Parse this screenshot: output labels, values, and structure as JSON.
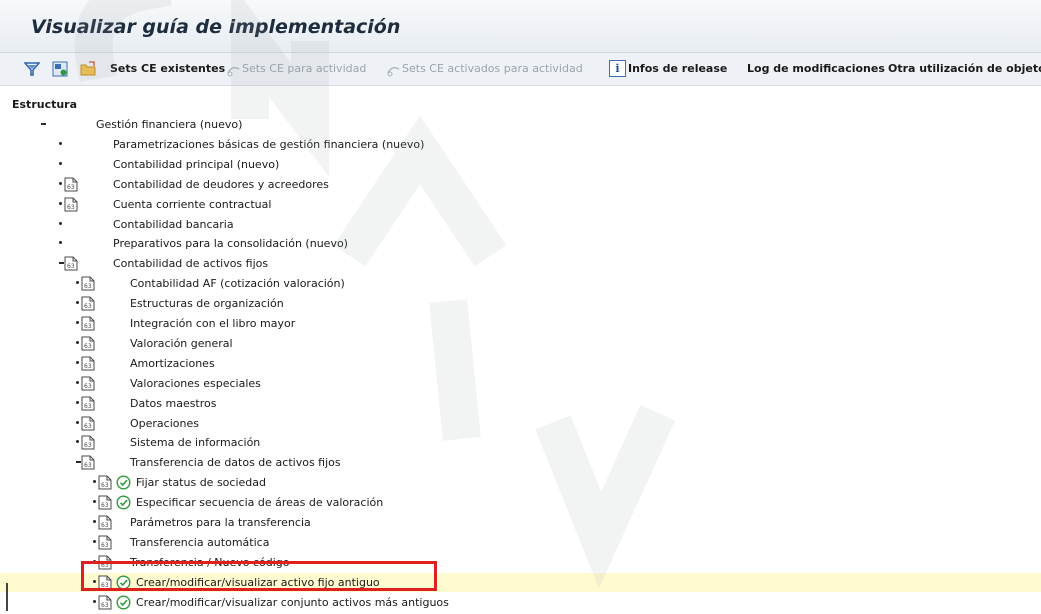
{
  "window": {
    "title": "Visualizar guía de implementación"
  },
  "toolbar": {
    "icons": [
      "filter-expand-icon",
      "execute-save-icon",
      "folder-icon"
    ],
    "sets_ce_existentes": "Sets CE existentes",
    "sets_ce_actividad": "Sets CE para actividad",
    "sets_ce_activados": "Sets CE activados para actividad",
    "infos_release": "Infos de release",
    "log_modificaciones": "Log de modificaciones",
    "otra_utilizacion": "Otra utilización de objeto"
  },
  "tree": {
    "heading": "Estructura",
    "nodes": [
      {
        "label": "Gestión financiera (nuevo)",
        "level": 0,
        "expanded": true,
        "doc": false,
        "exec": false
      },
      {
        "label": "Parametrizaciones básicas de gestión financiera (nuevo)",
        "level": 1,
        "expanded": false,
        "doc": false,
        "exec": false
      },
      {
        "label": "Contabilidad principal (nuevo)",
        "level": 1,
        "expanded": false,
        "doc": false,
        "exec": false
      },
      {
        "label": "Contabilidad de deudores y acreedores",
        "level": 1,
        "expanded": false,
        "doc": true,
        "exec": false
      },
      {
        "label": "Cuenta corriente contractual",
        "level": 1,
        "expanded": false,
        "doc": true,
        "exec": false
      },
      {
        "label": "Contabilidad bancaria",
        "level": 1,
        "expanded": false,
        "doc": false,
        "exec": false
      },
      {
        "label": "Preparativos para la consolidación (nuevo)",
        "level": 1,
        "expanded": false,
        "doc": false,
        "exec": false
      },
      {
        "label": "Contabilidad de activos fijos",
        "level": 1,
        "expanded": true,
        "doc": true,
        "exec": false
      },
      {
        "label": "Contabilidad AF (cotización valoración)",
        "level": 2,
        "expanded": false,
        "doc": true,
        "exec": false
      },
      {
        "label": "Estructuras de organización",
        "level": 2,
        "expanded": false,
        "doc": true,
        "exec": false
      },
      {
        "label": "Integración con el libro mayor",
        "level": 2,
        "expanded": false,
        "doc": true,
        "exec": false
      },
      {
        "label": "Valoración general",
        "level": 2,
        "expanded": false,
        "doc": true,
        "exec": false
      },
      {
        "label": "Amortizaciones",
        "level": 2,
        "expanded": false,
        "doc": true,
        "exec": false
      },
      {
        "label": "Valoraciones especiales",
        "level": 2,
        "expanded": false,
        "doc": true,
        "exec": false
      },
      {
        "label": "Datos maestros",
        "level": 2,
        "expanded": false,
        "doc": true,
        "exec": false
      },
      {
        "label": "Operaciones",
        "level": 2,
        "expanded": false,
        "doc": true,
        "exec": false
      },
      {
        "label": "Sistema de información",
        "level": 2,
        "expanded": false,
        "doc": true,
        "exec": false
      },
      {
        "label": "Transferencia de datos de activos fijos",
        "level": 2,
        "expanded": true,
        "doc": true,
        "exec": false
      },
      {
        "label": "Fijar status de sociedad",
        "level": 3,
        "expanded": false,
        "doc": true,
        "exec": true
      },
      {
        "label": "Especificar secuencia de áreas de valoración",
        "level": 3,
        "expanded": false,
        "doc": true,
        "exec": true
      },
      {
        "label": "Parámetros para la transferencia",
        "level": 3,
        "expanded": false,
        "doc": true,
        "exec": false
      },
      {
        "label": "Transferencia automática",
        "level": 3,
        "expanded": false,
        "doc": true,
        "exec": false
      },
      {
        "label": "Transferencia / Nuevo código",
        "level": 3,
        "expanded": false,
        "doc": true,
        "exec": false
      },
      {
        "label": "Crear/modificar/visualizar activo fijo antiguo",
        "level": 3,
        "expanded": false,
        "doc": true,
        "exec": true,
        "selected": true
      },
      {
        "label": "Crear/modificar/visualizar conjunto activos más antiguos",
        "level": 3,
        "expanded": false,
        "doc": true,
        "exec": true
      }
    ]
  },
  "watermark": {
    "color": "#9aa0a6"
  },
  "colors": {
    "highlight_box": "#e02020",
    "selected_row": "#fffbd0",
    "exec_icon": "#2f9a3a"
  }
}
